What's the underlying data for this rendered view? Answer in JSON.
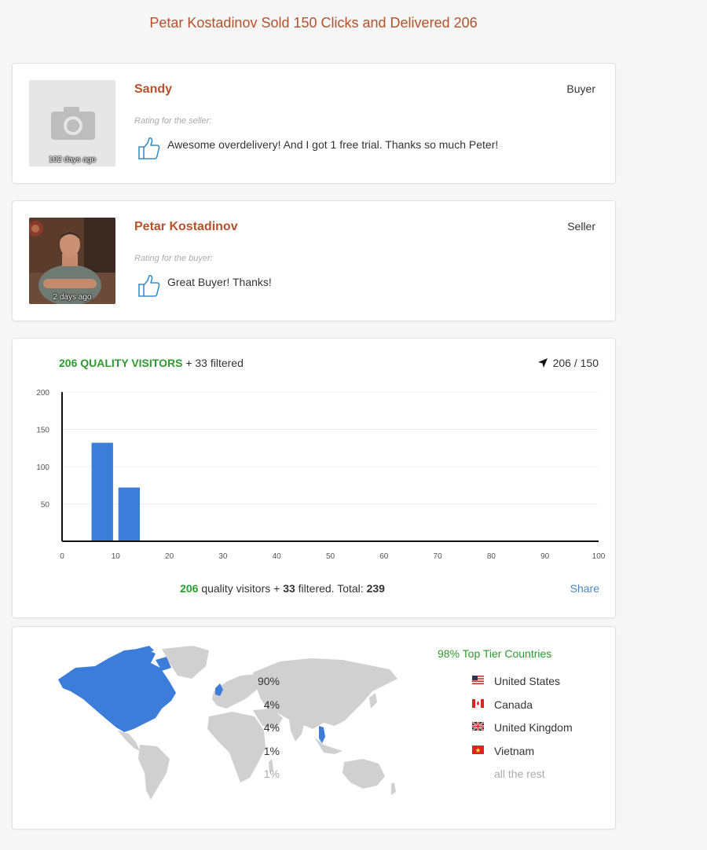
{
  "page": {
    "title": "Petar Kostadinov Sold 150 Clicks and Delivered 206"
  },
  "reviews": [
    {
      "name": "Sandy",
      "role": "Buyer",
      "time": "102 days ago",
      "rating_label": "Rating for the seller:",
      "comment": "Awesome overdelivery! And I got 1 free trial. Thanks so much Peter!",
      "avatar": "camera-placeholder-icon"
    },
    {
      "name": "Petar Kostadinov",
      "role": "Seller",
      "time": "2 days ago",
      "rating_label": "Rating for the buyer:",
      "comment": "Great Buyer! Thanks!",
      "avatar": "profile-photo"
    }
  ],
  "visitors": {
    "quality": "206 QUALITY VISITORS",
    "filtered_text": "+ 33 filtered",
    "delivered": "206 / 150",
    "footer": {
      "quality_num": "206",
      "quality_text": "quality visitors +",
      "filtered_num": "33",
      "filtered_text": "filtered. Total:",
      "total_num": "239"
    },
    "share_label": "Share"
  },
  "chart_data": {
    "type": "bar",
    "x": [
      7.5,
      12.5
    ],
    "values": [
      132,
      72
    ],
    "bar_width": 4,
    "xlim": [
      0,
      100
    ],
    "ylim": [
      0,
      200
    ],
    "xticks": [
      0,
      10,
      20,
      30,
      40,
      50,
      60,
      70,
      80,
      90,
      100
    ],
    "yticks": [
      50,
      100,
      150,
      200
    ],
    "color": "#3b7dd8",
    "title": "",
    "xlabel": "",
    "ylabel": ""
  },
  "countries": {
    "top_tier_label": "98% Top Tier Countries",
    "items": [
      {
        "pct": "90%",
        "name": "United States",
        "flag": "us-flag-icon"
      },
      {
        "pct": "4%",
        "name": "Canada",
        "flag": "ca-flag-icon"
      },
      {
        "pct": "4%",
        "name": "United Kingdom",
        "flag": "uk-flag-icon"
      },
      {
        "pct": "1%",
        "name": "Vietnam",
        "flag": "vn-flag-icon"
      }
    ],
    "rest": {
      "pct": "1%",
      "name": "all the rest"
    },
    "map_highlight_color": "#3b7dd8",
    "map_base_color": "#d0d0d0"
  }
}
